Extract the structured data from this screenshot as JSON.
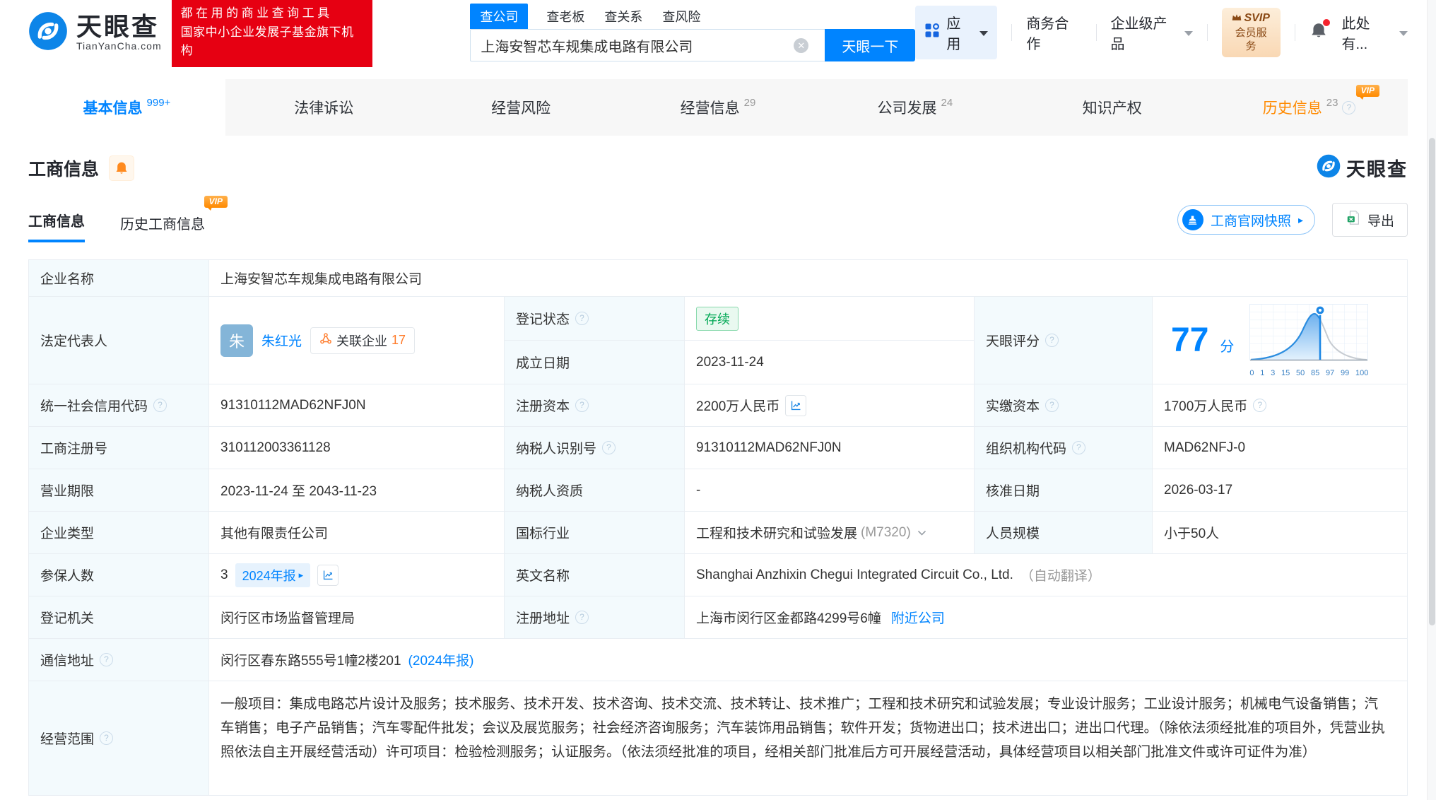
{
  "header": {
    "brand": {
      "name": "天眼查",
      "domain": "TianYanCha.com"
    },
    "promo": {
      "line1": "都在用的商业查询工具",
      "line2": "国家中小企业发展子基金旗下机构"
    },
    "search": {
      "tabs": [
        {
          "label": "查公司"
        },
        {
          "label": "查老板"
        },
        {
          "label": "查关系"
        },
        {
          "label": "查风险"
        }
      ],
      "value": "上海安智芯车规集成电路有限公司",
      "button": "天眼一下"
    },
    "nav": {
      "apps": "应用",
      "cooperation": "商务合作",
      "enterprise": "企业级产品",
      "svip_top": "SVIP",
      "svip_bottom": "会员服务",
      "account": "此处有..."
    }
  },
  "nav_tabs": [
    {
      "label": "基本信息",
      "count": "999+"
    },
    {
      "label": "法律诉讼",
      "count": ""
    },
    {
      "label": "经营风险",
      "count": ""
    },
    {
      "label": "经营信息",
      "count": "29"
    },
    {
      "label": "公司发展",
      "count": "24"
    },
    {
      "label": "知识产权",
      "count": ""
    },
    {
      "label": "历史信息",
      "count": "23",
      "vip": "VIP"
    }
  ],
  "section": {
    "title": "工商信息",
    "watermark": "天眼查",
    "subtabs": [
      {
        "label": "工商信息"
      },
      {
        "label": "历史工商信息",
        "vip": "VIP"
      }
    ],
    "snapshot_button": "工商官网快照",
    "export_button": "导出"
  },
  "score": {
    "label": "天眼评分",
    "value": "77",
    "unit": "分",
    "axis": [
      "0",
      "1",
      "3",
      "15",
      "50",
      "85",
      "97",
      "99",
      "100"
    ],
    "marker_value": 77
  },
  "info": {
    "company_name": {
      "label": "企业名称",
      "value": "上海安智芯车规集成电路有限公司"
    },
    "legal_rep": {
      "label": "法定代表人",
      "avatar": "朱",
      "name": "朱红光",
      "related_label": "关联企业",
      "related_count": "17"
    },
    "reg_status": {
      "label": "登记状态",
      "value": "存续"
    },
    "establish_date": {
      "label": "成立日期",
      "value": "2023-11-24"
    },
    "credit_code": {
      "label": "统一社会信用代码",
      "value": "91310112MAD62NFJ0N"
    },
    "reg_capital": {
      "label": "注册资本",
      "value": "2200万人民币"
    },
    "paid_capital": {
      "label": "实缴资本",
      "value": "1700万人民币"
    },
    "reg_number": {
      "label": "工商注册号",
      "value": "310112003361128"
    },
    "taxpayer_id": {
      "label": "纳税人识别号",
      "value": "91310112MAD62NFJ0N"
    },
    "org_code": {
      "label": "组织机构代码",
      "value": "MAD62NFJ-0"
    },
    "business_term": {
      "label": "营业期限",
      "value": "2023-11-24 至 2043-11-23"
    },
    "taxpayer_quality": {
      "label": "纳税人资质",
      "value": "-"
    },
    "approval_date": {
      "label": "核准日期",
      "value": "2026-03-17"
    },
    "company_type": {
      "label": "企业类型",
      "value": "其他有限责任公司"
    },
    "industry": {
      "label": "国标行业",
      "value": "工程和技术研究和试验发展",
      "code": "(M7320)"
    },
    "staff_size": {
      "label": "人员规模",
      "value": "小于50人"
    },
    "insured": {
      "label": "参保人数",
      "value": "3",
      "report": "2024年报"
    },
    "english_name": {
      "label": "英文名称",
      "value": "Shanghai Anzhixin Chegui Integrated Circuit Co., Ltd.",
      "note": "（自动翻译）"
    },
    "reg_authority": {
      "label": "登记机关",
      "value": "闵行区市场监督管理局"
    },
    "reg_address": {
      "label": "注册地址",
      "value": "上海市闵行区金都路4299号6幢",
      "link": "附近公司"
    },
    "mail_address": {
      "label": "通信地址",
      "value": "闵行区春东路555号1幢2楼201",
      "link": "(2024年报)"
    },
    "business_scope": {
      "label": "经营范围",
      "value": "一般项目：集成电路芯片设计及服务；技术服务、技术开发、技术咨询、技术交流、技术转让、技术推广；工程和技术研究和试验发展；专业设计服务；工业设计服务；机械电气设备销售；汽车销售；电子产品销售；汽车零配件批发；会议及展览服务；社会经济咨询服务；汽车装饰用品销售；软件开发；货物进出口；技术进出口；进出口代理。（除依法须经批准的项目外，凭营业执照依法自主开展经营活动）许可项目：检验检测服务；认证服务。（依法须经批准的项目，经相关部门批准后方可开展经营活动，具体经营项目以相关部门批准文件或许可证件为准）"
    }
  }
}
